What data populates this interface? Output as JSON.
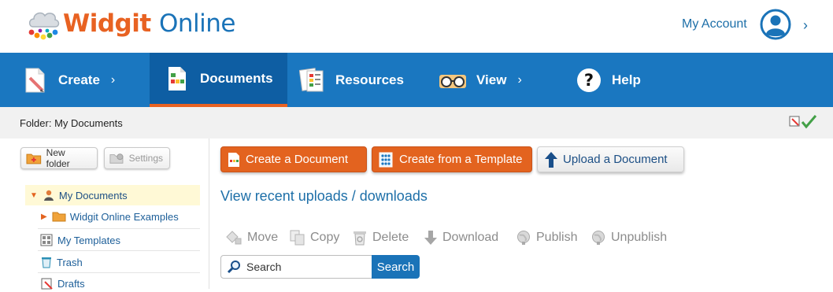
{
  "header": {
    "logo_brand": "Widgit",
    "logo_suffix": "Online",
    "account_label": "My Account"
  },
  "nav": [
    {
      "label": "Create",
      "icon": "pencil-page-icon",
      "has_chevron": true
    },
    {
      "label": "Documents",
      "icon": "document-icon",
      "has_chevron": false,
      "active": true
    },
    {
      "label": "Resources",
      "icon": "resources-icon",
      "has_chevron": false
    },
    {
      "label": "View",
      "icon": "glasses-icon",
      "has_chevron": true
    },
    {
      "label": "Help",
      "icon": "help-icon",
      "has_chevron": false
    }
  ],
  "folderbar": {
    "path": "Folder: My Documents"
  },
  "left": {
    "new_folder_label": "New folder",
    "settings_label": "Settings",
    "tree": [
      {
        "label": "My Documents",
        "icon": "user-folder-icon",
        "selected": true
      },
      {
        "label": "Widgit Online Examples",
        "icon": "folder-icon"
      },
      {
        "label": "My Templates",
        "icon": "templates-icon"
      },
      {
        "label": "Trash",
        "icon": "trash-icon"
      },
      {
        "label": "Drafts",
        "icon": "drafts-icon"
      }
    ]
  },
  "main": {
    "create_document_label": "Create a Document",
    "create_template_label": "Create from a Template",
    "upload_label": "Upload a Document",
    "recent_link": "View recent uploads / downloads",
    "toolbar": [
      "Move",
      "Copy",
      "Delete",
      "Download",
      "Publish",
      "Unpublish"
    ],
    "search_placeholder": "Search",
    "search_button": "Search"
  },
  "colors": {
    "nav_bg": "#1a77c0",
    "nav_active": "#0e5ea3",
    "accent_orange": "#e3631f",
    "link_blue": "#1d6fa8"
  }
}
